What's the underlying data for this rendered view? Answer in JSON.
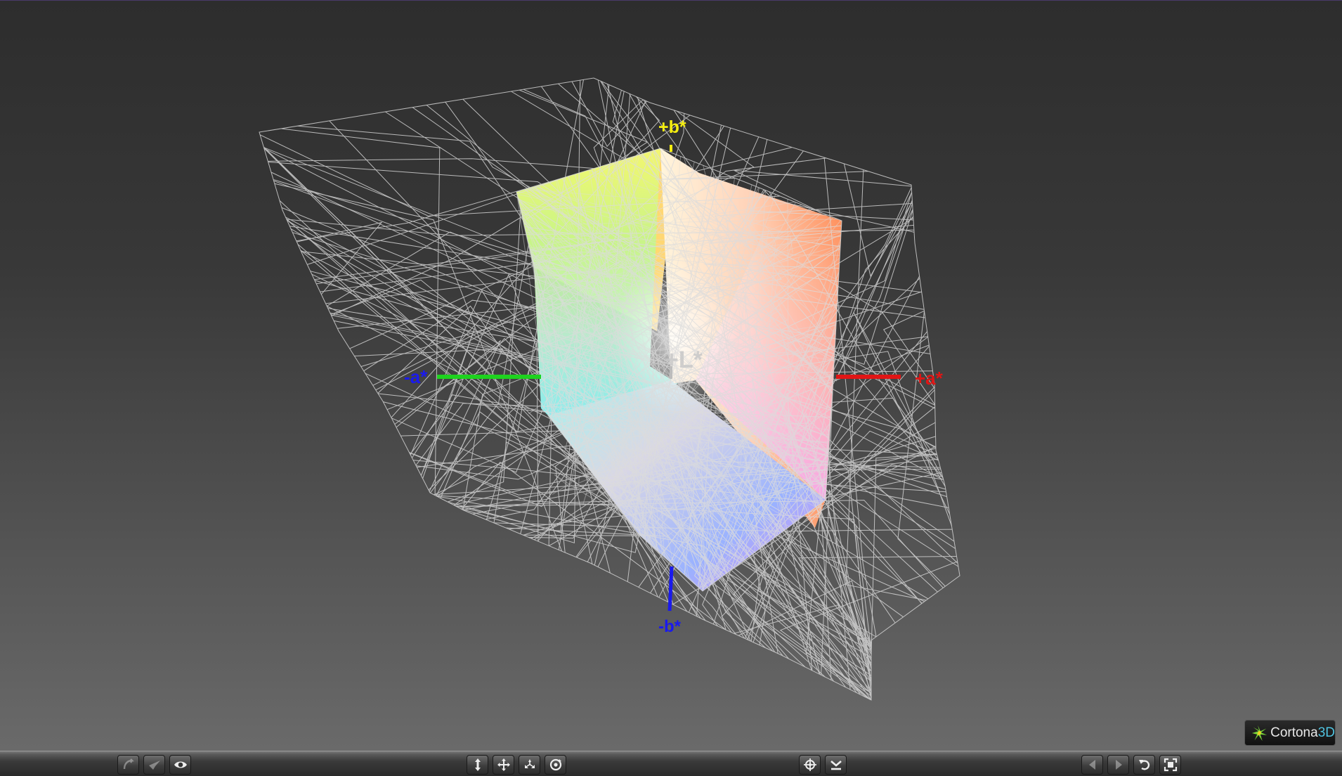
{
  "viewer": {
    "axes": {
      "plus_b": "+b*",
      "minus_b": "-b*",
      "plus_a": "+a*",
      "minus_a": "-a*",
      "plus_L": "+L*"
    },
    "logo": {
      "name": "Cortona",
      "suffix": "3D"
    },
    "colors": {
      "a_positive": "#e01515",
      "a_negative": "#1ed21e",
      "b_negative": "#1a1aee",
      "b_positive": "#f5ee10",
      "wireframe": "#dcdcdc"
    }
  },
  "toolbar": {
    "groups": [
      {
        "name": "left",
        "icons": [
          "navigation-mode-icon",
          "plane-mode-icon",
          "view-mode-icon"
        ]
      },
      {
        "name": "center",
        "icons": [
          "walk-icon",
          "pan-icon",
          "fly-icon",
          "examine-icon"
        ]
      },
      {
        "name": "center-right",
        "icons": [
          "goto-icon",
          "straighten-icon"
        ]
      },
      {
        "name": "right",
        "icons": [
          "previous-viewpoint-icon",
          "next-viewpoint-icon",
          "restore-view-icon",
          "fit-view-icon"
        ]
      }
    ]
  }
}
